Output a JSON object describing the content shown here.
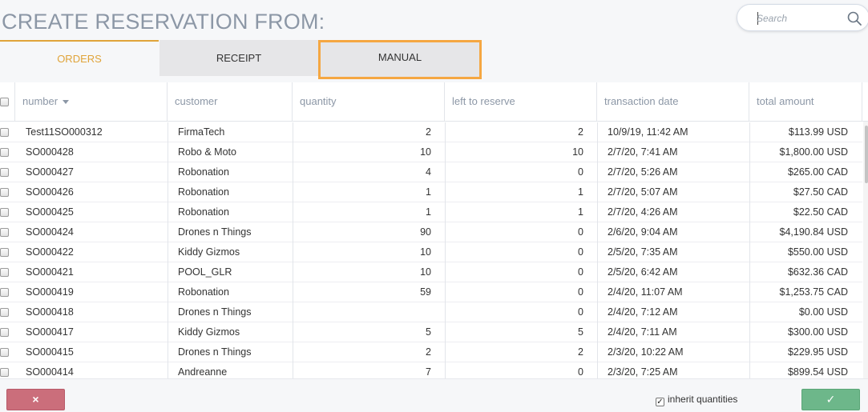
{
  "header": {
    "title": "CREATE RESERVATION FROM:",
    "search_placeholder": "Search"
  },
  "tabs": [
    {
      "label": "ORDERS",
      "active": true
    },
    {
      "label": "RECEIPT",
      "active": false
    },
    {
      "label": "MANUAL",
      "active": false
    }
  ],
  "table": {
    "columns": [
      "number",
      "customer",
      "quantity",
      "left to reserve",
      "transaction date",
      "total amount"
    ],
    "rows": [
      [
        "Test11SO000312",
        "FirmaTech",
        "2",
        "2",
        "10/9/19, 11:42 AM",
        "$113.99 USD"
      ],
      [
        "SO000428",
        "Robo & Moto",
        "10",
        "10",
        "2/7/20, 7:41 AM",
        "$1,800.00 USD"
      ],
      [
        "SO000427",
        "Robonation",
        "4",
        "0",
        "2/7/20, 5:26 AM",
        "$265.00 CAD"
      ],
      [
        "SO000426",
        "Robonation",
        "1",
        "1",
        "2/7/20, 5:07 AM",
        "$27.50 CAD"
      ],
      [
        "SO000425",
        "Robonation",
        "1",
        "1",
        "2/7/20, 4:26 AM",
        "$22.50 CAD"
      ],
      [
        "SO000424",
        "Drones n Things",
        "90",
        "0",
        "2/6/20, 9:04 AM",
        "$4,190.84 USD"
      ],
      [
        "SO000422",
        "Kiddy Gizmos",
        "10",
        "0",
        "2/5/20, 7:35 AM",
        "$550.00 USD"
      ],
      [
        "SO000421",
        "POOL_GLR",
        "10",
        "0",
        "2/5/20, 6:42 AM",
        "$632.36 CAD"
      ],
      [
        "SO000419",
        "Robonation",
        "59",
        "0",
        "2/4/20, 11:07 AM",
        "$1,253.75 CAD"
      ],
      [
        "SO000418",
        "Drones n Things",
        "",
        "0",
        "2/4/20, 7:12 AM",
        "$0.00 USD"
      ],
      [
        "SO000417",
        "Kiddy Gizmos",
        "5",
        "5",
        "2/4/20, 7:11 AM",
        "$300.00 USD"
      ],
      [
        "SO000415",
        "Drones n Things",
        "2",
        "2",
        "2/3/20, 10:22 AM",
        "$229.95 USD"
      ],
      [
        "SO000414",
        "Andreanne",
        "7",
        "0",
        "2/3/20, 7:25 AM",
        "$899.54 USD"
      ]
    ]
  },
  "footer": {
    "cancel_icon": "×",
    "inherit_label": "inherit quantities",
    "inherit_checked": true,
    "confirm_icon": "✓"
  },
  "colors": {
    "accent": "#e0a43a",
    "manual_highlight": "#f5a742",
    "cancel": "#cb6e7b",
    "confirm": "#6db78a"
  }
}
